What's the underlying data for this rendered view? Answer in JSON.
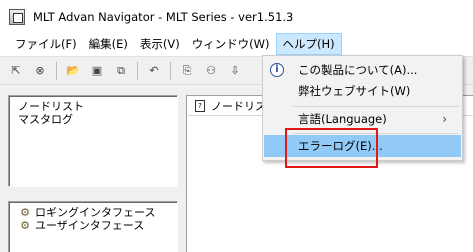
{
  "window": {
    "title": "MLT Advan Navigator - MLT Series - ver1.51.3"
  },
  "menubar": [
    {
      "label": "ファイル(F)",
      "active": false
    },
    {
      "label": "編集(E)",
      "active": false
    },
    {
      "label": "表示(V)",
      "active": false
    },
    {
      "label": "ウィンドウ(W)",
      "active": false
    },
    {
      "label": "ヘルプ(H)",
      "active": true
    }
  ],
  "toolbar": {
    "icons": [
      "pointer-icon",
      "stop-icon",
      "open-folder-icon",
      "save-icon",
      "copy-window-icon",
      "undo-icon",
      "copy-icon",
      "binoculars-icon",
      "download-icon",
      "paste-icon"
    ]
  },
  "left_panel": {
    "node_list": [
      "ノードリスト",
      "マスタログ"
    ],
    "interfaces": [
      "ロギングインタフェース",
      "ユーザインタフェース"
    ]
  },
  "mdi": {
    "tab_title": "ノードリスト"
  },
  "help_menu": {
    "items": [
      {
        "label": "この製品について(A)...",
        "icon": "info-icon",
        "submenu": false
      },
      {
        "label": "弊社ウェブサイト(W)",
        "icon": "",
        "submenu": false
      },
      {
        "label": "言語(Language)",
        "icon": "",
        "submenu": true
      },
      {
        "label": "エラーログ(E)...",
        "icon": "",
        "submenu": false,
        "highlighted": true
      }
    ]
  },
  "colors": {
    "highlight": "#91c9f7",
    "menu_active": "#cce8ff",
    "annotation": "#e01818"
  }
}
